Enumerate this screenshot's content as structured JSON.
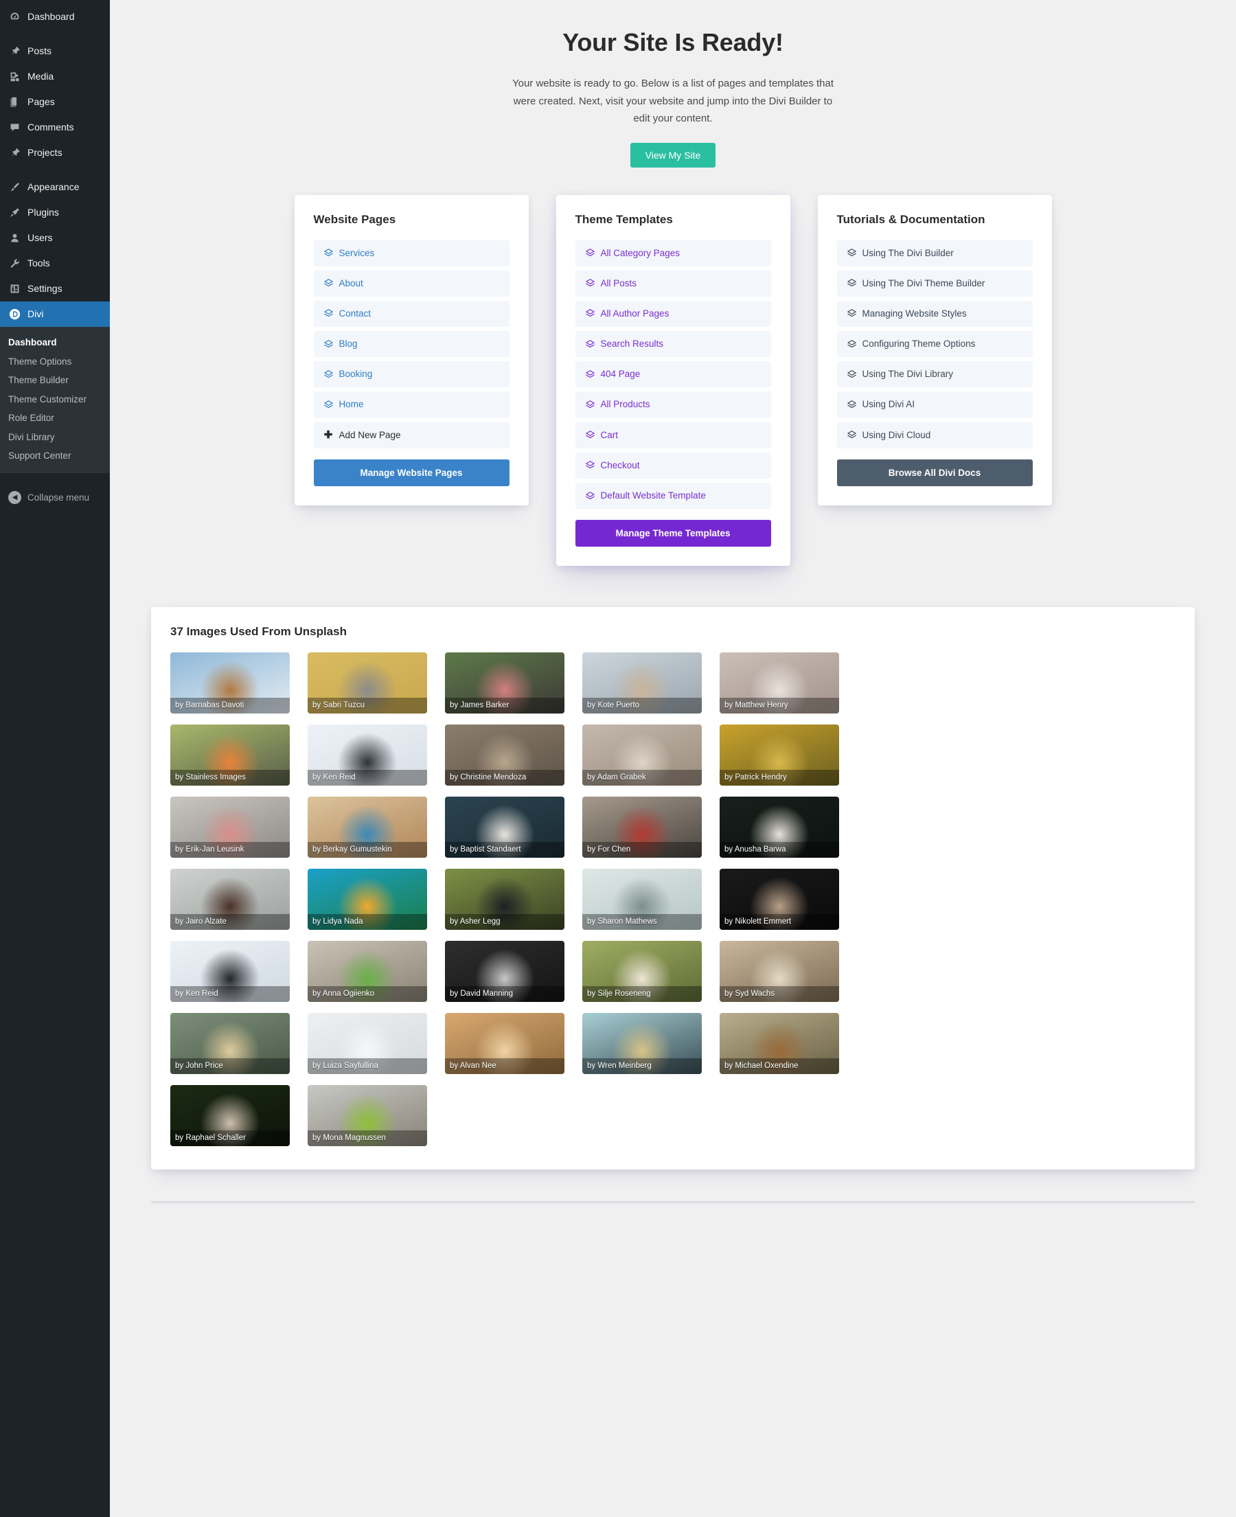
{
  "sidebar": {
    "items": [
      {
        "label": "Dashboard",
        "icon": "dashboard-icon",
        "group": 0
      },
      {
        "label": "Posts",
        "icon": "pin-icon",
        "group": 1
      },
      {
        "label": "Media",
        "icon": "media-icon",
        "group": 1
      },
      {
        "label": "Pages",
        "icon": "pages-icon",
        "group": 1
      },
      {
        "label": "Comments",
        "icon": "comments-icon",
        "group": 1
      },
      {
        "label": "Projects",
        "icon": "pin-icon",
        "group": 1
      },
      {
        "label": "Appearance",
        "icon": "appearance-brush-icon",
        "group": 2
      },
      {
        "label": "Plugins",
        "icon": "plugins-icon",
        "group": 2
      },
      {
        "label": "Users",
        "icon": "users-icon",
        "group": 2
      },
      {
        "label": "Tools",
        "icon": "wrench-icon",
        "group": 2
      },
      {
        "label": "Settings",
        "icon": "settings-sliders-icon",
        "group": 2
      }
    ],
    "active_item": {
      "label": "Divi",
      "icon": "divi-logo-icon"
    },
    "submenu": [
      "Dashboard",
      "Theme Options",
      "Theme Builder",
      "Theme Customizer",
      "Role Editor",
      "Divi Library",
      "Support Center"
    ],
    "submenu_current": "Dashboard",
    "collapse": {
      "label": "Collapse menu",
      "icon": "caret-left-circle-icon"
    }
  },
  "hero": {
    "title": "Your Site Is Ready!",
    "description": "Your website is ready to go. Below is a list of pages and templates that were created. Next, visit your website and jump into the Divi Builder to edit your content.",
    "cta_label": "View My Site",
    "cta_color": "#2bbfa1"
  },
  "cards": {
    "pages": {
      "title": "Website Pages",
      "link_color": "#2f7ec4",
      "items": [
        "Services",
        "About",
        "Contact",
        "Blog",
        "Booking",
        "Home"
      ],
      "add_new_label": "Add New Page",
      "button_label": "Manage Website Pages",
      "button_color": "#3a83c9"
    },
    "templates": {
      "title": "Theme Templates",
      "link_color": "#7b2fd0",
      "items": [
        "All Category Pages",
        "All Posts",
        "All Author Pages",
        "Search Results",
        "404 Page",
        "All Products",
        "Cart",
        "Checkout",
        "Default Website Template"
      ],
      "button_label": "Manage Theme Templates",
      "button_color": "#7528d1"
    },
    "docs": {
      "title": "Tutorials & Documentation",
      "link_color": "#3c4858",
      "items": [
        "Using The Divi Builder",
        "Using The Divi Theme Builder",
        "Managing Website Styles",
        "Configuring Theme Options",
        "Using The Divi Library",
        "Using Divi AI",
        "Using Divi Cloud"
      ],
      "button_label": "Browse All Divi Docs",
      "button_color": "#4e5d6c"
    }
  },
  "images": {
    "title": "37 Images Used From Unsplash",
    "tiles": [
      {
        "caption": "by Barnabas Davoti",
        "c1": "#8fb8d8",
        "c2": "#e4ecf2",
        "c3": "#b07a42"
      },
      {
        "caption": "by Sabri Tuzcu",
        "c1": "#d8bb62",
        "c2": "#c8a84e",
        "c3": "#8b8b8b"
      },
      {
        "caption": "by James Barker",
        "c1": "#5d7a4a",
        "c2": "#3d3a36",
        "c3": "#d2807f"
      },
      {
        "caption": "by Kote Puerto",
        "c1": "#cdd6dd",
        "c2": "#9aa5ad",
        "c3": "#c8b49a"
      },
      {
        "caption": "by Matthew Henry",
        "c1": "#cbbfb8",
        "c2": "#a3938b",
        "c3": "#e8e2dd"
      },
      {
        "caption": "by Stainless Images",
        "c1": "#a8b86a",
        "c2": "#5a5f4a",
        "c3": "#e8833a"
      },
      {
        "caption": "by Ken Reid",
        "c1": "#eef2f7",
        "c2": "#d7dee6",
        "c3": "#2d3338"
      },
      {
        "caption": "by Christine Mendoza",
        "c1": "#8c7e6d",
        "c2": "#5e5348",
        "c3": "#b8a68e"
      },
      {
        "caption": "by Adam Grabek",
        "c1": "#c4b9ae",
        "c2": "#9a8b7c",
        "c3": "#ded4c8"
      },
      {
        "caption": "by Patrick Hendry",
        "c1": "#c9a22c",
        "c2": "#6c6020",
        "c3": "#d8b84c"
      },
      {
        "caption": "by Erik-Jan Leusink",
        "c1": "#c9c6c1",
        "c2": "#8e8a85",
        "c3": "#d98f8a"
      },
      {
        "caption": "by Berkay Gumustekin",
        "c1": "#dcc49c",
        "c2": "#b0855a",
        "c3": "#3f88b5"
      },
      {
        "caption": "by Baptist Standaert",
        "c1": "#2b4450",
        "c2": "#1a2b33",
        "c3": "#e8e4df"
      },
      {
        "caption": "by For Chen",
        "c1": "#a59a8c",
        "c2": "#4b4540",
        "c3": "#b23a32"
      },
      {
        "caption": "by Anusha Barwa",
        "c1": "#17201c",
        "c2": "#0c120f",
        "c3": "#e6e2da"
      },
      {
        "caption": "by Jairo Alzate",
        "c1": "#cfd2d0",
        "c2": "#9aa09d",
        "c3": "#4a3126"
      },
      {
        "caption": "by Lidya Nada",
        "c1": "#1ba0c8",
        "c2": "#1b7f4a",
        "c3": "#f0a830"
      },
      {
        "caption": "by Asher Legg",
        "c1": "#7e9046",
        "c2": "#3a4224",
        "c3": "#1d2124"
      },
      {
        "caption": "by Sharon Mathews",
        "c1": "#dfe7e6",
        "c2": "#b5c6c5",
        "c3": "#7d8f8e"
      },
      {
        "caption": "by Nikolett Emmert",
        "c1": "#1a1a1a",
        "c2": "#0a0a0a",
        "c3": "#b9a089"
      },
      {
        "caption": "by Ken Reid",
        "c1": "#eef2f7",
        "c2": "#cfd8e1",
        "c3": "#22272b"
      },
      {
        "caption": "by Anna Ogiienko",
        "c1": "#c9c2b5",
        "c2": "#8b8375",
        "c3": "#69b047"
      },
      {
        "caption": "by David Manning",
        "c1": "#2e2e2e",
        "c2": "#141414",
        "c3": "#c8c8c8"
      },
      {
        "caption": "by Silje Roseneng",
        "c1": "#9fae62",
        "c2": "#5e6a36",
        "c3": "#ece5d4"
      },
      {
        "caption": "by Syd Wachs",
        "c1": "#c8b79d",
        "c2": "#7c6a52",
        "c3": "#e4dac6"
      },
      {
        "caption": "by John Price",
        "c1": "#7d8f7a",
        "c2": "#4a5a48",
        "c3": "#e0cc9d"
      },
      {
        "caption": "by Luiza Sayfullina",
        "c1": "#eef0f2",
        "c2": "#d5dadd",
        "c3": "#f7f8f9"
      },
      {
        "caption": "by Alvan Nee",
        "c1": "#d8a870",
        "c2": "#8f6a3c",
        "c3": "#f0d3a6"
      },
      {
        "caption": "by Wren Meinberg",
        "c1": "#a8cfd4",
        "c2": "#3a4e56",
        "c3": "#d8c488"
      },
      {
        "caption": "by Michael Oxendine",
        "c1": "#b9ae8c",
        "c2": "#6a6044",
        "c3": "#9a6b3a"
      },
      {
        "caption": "by Raphael Schaller",
        "c1": "#1c2a14",
        "c2": "#0c1409",
        "c3": "#cdbfae"
      },
      {
        "caption": "by Mona Magnussen",
        "c1": "#c6c9c4",
        "c2": "#8a8278",
        "c3": "#8fc03a"
      }
    ]
  }
}
